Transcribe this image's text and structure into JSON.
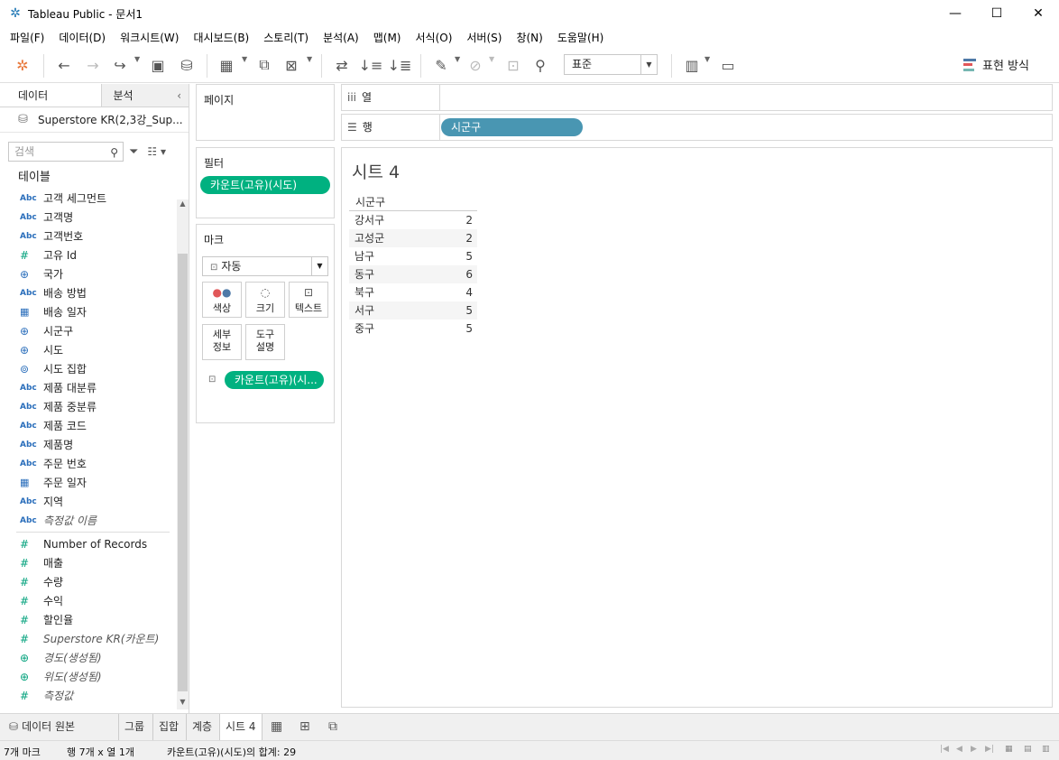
{
  "window": {
    "title": "Tableau Public - 문서1",
    "minimize": "—",
    "maximize": "☐",
    "close": "✕"
  },
  "menu": [
    "파일(F)",
    "데이터(D)",
    "워크시트(W)",
    "대시보드(B)",
    "스토리(T)",
    "분석(A)",
    "맵(M)",
    "서식(O)",
    "서버(S)",
    "창(N)",
    "도움말(H)"
  ],
  "toolbar": {
    "format_select": "표준",
    "show_me": "표현 방식"
  },
  "left_pane": {
    "tab_data": "데이터",
    "tab_analysis": "분석",
    "datasource": "Superstore KR(2,3강_Sup...",
    "search_placeholder": "검색",
    "table_header": "테이블",
    "dimensions": [
      {
        "type": "Abc",
        "name": "고객 세그먼트"
      },
      {
        "type": "Abc",
        "name": "고객명"
      },
      {
        "type": "Abc",
        "name": "고객번호"
      },
      {
        "type": "#",
        "name": "고유 Id"
      },
      {
        "type": "geo",
        "name": "국가"
      },
      {
        "type": "Abc",
        "name": "배송 방법"
      },
      {
        "type": "date",
        "name": "배송 일자"
      },
      {
        "type": "geo",
        "name": "시군구"
      },
      {
        "type": "geo",
        "name": "시도"
      },
      {
        "type": "set",
        "name": "시도 집합"
      },
      {
        "type": "Abc",
        "name": "제품 대분류"
      },
      {
        "type": "Abc",
        "name": "제품 중분류"
      },
      {
        "type": "Abc",
        "name": "제품 코드"
      },
      {
        "type": "Abc",
        "name": "제품명"
      },
      {
        "type": "Abc",
        "name": "주문 번호"
      },
      {
        "type": "date",
        "name": "주문 일자"
      },
      {
        "type": "Abc",
        "name": "지역"
      },
      {
        "type": "Abc",
        "name": "측정값 이름",
        "italic": true
      }
    ],
    "measures": [
      {
        "type": "#",
        "name": "Number of Records"
      },
      {
        "type": "#",
        "name": "매출"
      },
      {
        "type": "#",
        "name": "수량"
      },
      {
        "type": "#",
        "name": "수익"
      },
      {
        "type": "#",
        "name": "할인율"
      },
      {
        "type": "#",
        "name": "Superstore KR(카운트)",
        "italic": true
      },
      {
        "type": "geo",
        "name": "경도(생성됨)",
        "italic": true
      },
      {
        "type": "geo",
        "name": "위도(생성됨)",
        "italic": true
      },
      {
        "type": "#",
        "name": "측정값",
        "italic": true
      }
    ]
  },
  "cards": {
    "pages": "페이지",
    "filters": "필터",
    "filter_pill": "카운트(고유)(시도)",
    "marks": "마크",
    "mark_type": "자동",
    "mark_buttons": {
      "color": "색상",
      "size": "크기",
      "text": "텍스트",
      "detail": "세부 정보",
      "tooltip": "도구 설명"
    },
    "marks_pill": "카운트(고유)(시..."
  },
  "shelves": {
    "columns": "열",
    "rows": "행",
    "rows_pill": "시군구"
  },
  "view": {
    "sheet_title": "시트 4",
    "column_header": "시군구",
    "rows": [
      {
        "name": "강서구",
        "value": "2"
      },
      {
        "name": "고성군",
        "value": "2"
      },
      {
        "name": "남구",
        "value": "5"
      },
      {
        "name": "동구",
        "value": "6"
      },
      {
        "name": "북구",
        "value": "4"
      },
      {
        "name": "서구",
        "value": "5"
      },
      {
        "name": "중구",
        "value": "5"
      }
    ]
  },
  "bottom_tabs": {
    "data_source": "데이터 원본",
    "tabs": [
      "그룹",
      "집합",
      "계층",
      "시트 4"
    ]
  },
  "status": {
    "marks": "7개 마크",
    "rows_cols": "행 7개 x 열 1개",
    "sum": "카운트(고유)(시도)의 합계: 29"
  },
  "colors": {
    "green_pill": "#00b180",
    "blue_pill": "#4996b2",
    "dim_icon": "#2a6ebb",
    "measure_icon": "#00a17b"
  }
}
